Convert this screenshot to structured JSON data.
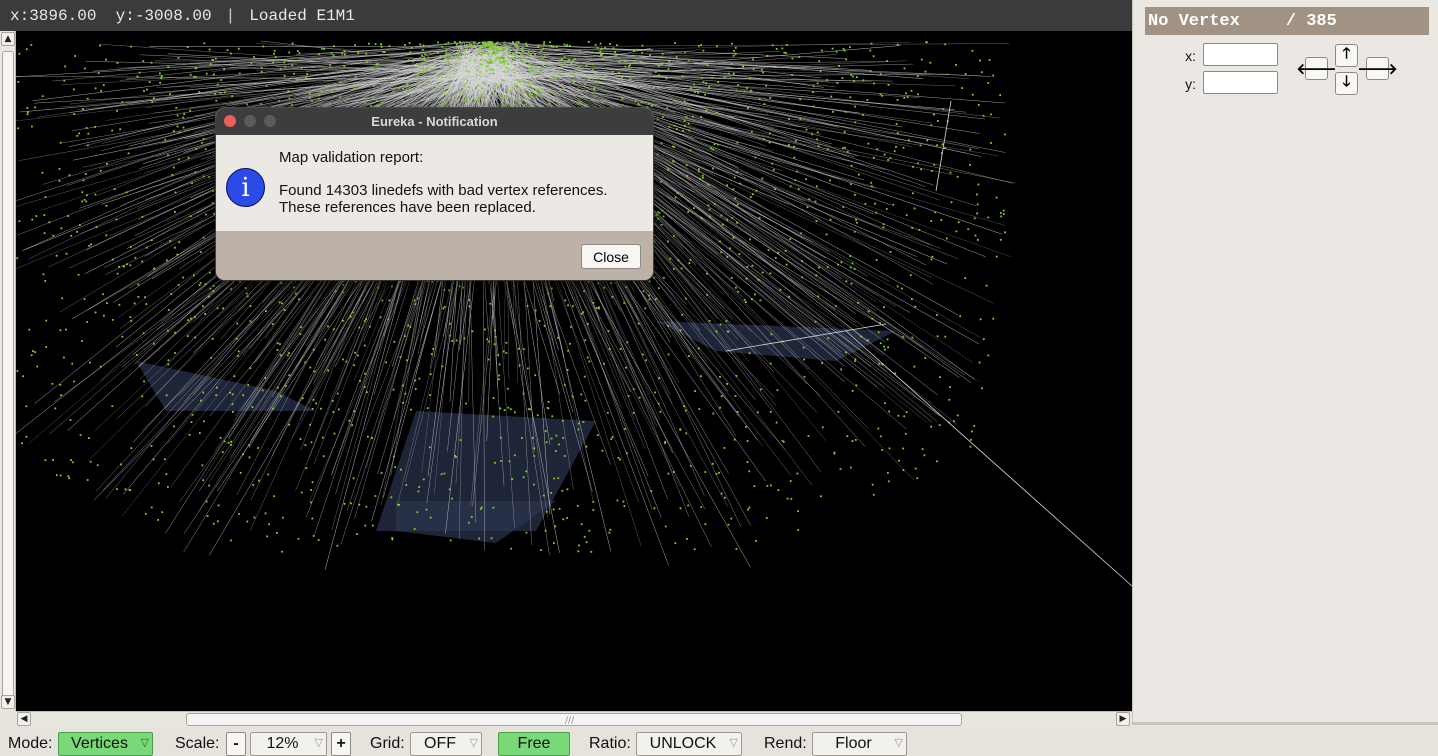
{
  "status_bar": {
    "coordinates": "x:3896.00  y:-3008.00",
    "separator": "|",
    "message": "Loaded E1M1"
  },
  "map_view": {
    "vertex_color": "#7ed321",
    "line_color": "#d8d8d8",
    "sector_fill_color": "#2c3550",
    "background_color": "#000000"
  },
  "side_panel": {
    "header_title": "No Vertex",
    "header_count": "/ 385",
    "x_label": "x:",
    "y_label": "y:",
    "x_value": "",
    "y_value": "",
    "nudge_buttons": {
      "up": "🡑",
      "left": "🡐",
      "right": "🡒",
      "down": "🡓"
    }
  },
  "toolbar": {
    "mode_label": "Mode:",
    "mode_value": "Vertices",
    "scale_label": "Scale:",
    "scale_minus": "-",
    "scale_value": "12%",
    "scale_plus": "+",
    "grid_label": "Grid:",
    "grid_value": "OFF",
    "free_value": "Free",
    "ratio_label": "Ratio:",
    "ratio_value": "UNLOCK",
    "rend_label": "Rend:",
    "rend_value": "Floor",
    "dropdown_glyph": "▽"
  },
  "dialog": {
    "title": "Eureka - Notification",
    "heading": "Map validation report:",
    "line1": "Found 14303 linedefs with bad vertex references.",
    "line2": "These references have been replaced.",
    "close_label": "Close",
    "icon_glyph": "i",
    "traffic_colors": [
      "#ec5f57",
      "#5a5a5a",
      "#5a5a5a"
    ]
  },
  "scrollbars": {
    "up_arrow": "▲",
    "down_arrow": "▼",
    "left_arrow": "◀",
    "right_arrow": "▶",
    "grip": "///"
  }
}
